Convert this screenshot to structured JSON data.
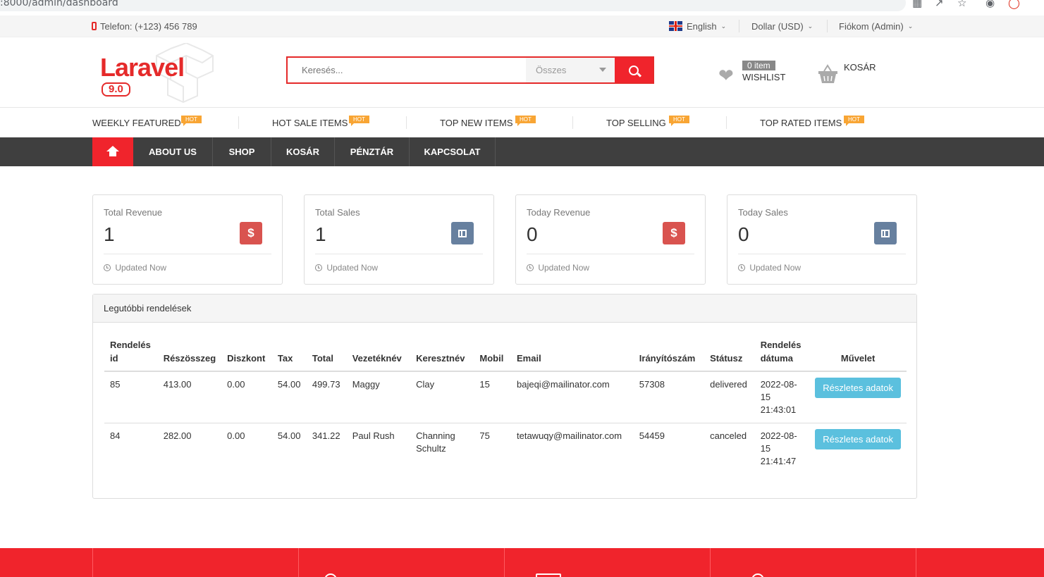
{
  "browser": {
    "url": ":8000/admin/dashboard"
  },
  "topbar": {
    "phone": "Telefon: (+123) 456 789",
    "language": "English",
    "currency": "Dollar (USD)",
    "account": "Fiókom (Admin)"
  },
  "header": {
    "logo_text": "Laravel",
    "logo_version": "9.0",
    "search_placeholder": "Keresés...",
    "search_category": "Összes",
    "wishlist_count": "0 item",
    "wishlist_label": "WISHLIST",
    "cart_label": "KOSÁR"
  },
  "featured": [
    {
      "label": "WEEKLY FEATURED",
      "badge": "HOT"
    },
    {
      "label": "HOT SALE ITEMS",
      "badge": "HOT"
    },
    {
      "label": "TOP NEW ITEMS",
      "badge": "HOT"
    },
    {
      "label": "TOP SELLING",
      "badge": "HOT"
    },
    {
      "label": "TOP RATED ITEMS",
      "badge": "HOT"
    }
  ],
  "nav": [
    "ABOUT US",
    "SHOP",
    "KOSÁR",
    "PÉNZTÁR",
    "KAPCSOLAT"
  ],
  "stats": [
    {
      "title": "Total Revenue",
      "value": "1",
      "icon": "dollar-icon",
      "color": "#d9534f",
      "foot": "Updated Now"
    },
    {
      "title": "Total Sales",
      "value": "1",
      "icon": "gift-icon",
      "color": "#67809f",
      "foot": "Updated Now"
    },
    {
      "title": "Today Revenue",
      "value": "0",
      "icon": "dollar-icon",
      "color": "#d9534f",
      "foot": "Updated Now"
    },
    {
      "title": "Today Sales",
      "value": "0",
      "icon": "gift-icon",
      "color": "#67809f",
      "foot": "Updated Now"
    }
  ],
  "orders": {
    "title": "Legutóbbi rendelések",
    "columns": [
      "Rendelés id",
      "Részösszeg",
      "Diszkont",
      "Tax",
      "Total",
      "Vezetéknév",
      "Keresztnév",
      "Mobil",
      "Email",
      "Irányítószám",
      "Státusz",
      "Rendelés dátuma",
      "Művelet"
    ],
    "rows": [
      {
        "id": "85",
        "subtotal": "413.00",
        "discount": "0.00",
        "tax": "54.00",
        "total": "499.73",
        "lastname": "Maggy",
        "firstname": "Clay",
        "mobile": "15",
        "email": "bajeqi@mailinator.com",
        "zip": "57308",
        "status": "delivered",
        "date": "2022-08-15 21:43:01",
        "action": "Részletes adatok"
      },
      {
        "id": "84",
        "subtotal": "282.00",
        "discount": "0.00",
        "tax": "54.00",
        "total": "341.22",
        "lastname": "Paul Rush",
        "firstname": "Channing Schultz",
        "mobile": "75",
        "email": "tetawuqy@mailinator.com",
        "zip": "54459",
        "status": "canceled",
        "date": "2022-08-15 21:41:47",
        "action": "Részletes adatok"
      }
    ]
  },
  "colors": {
    "brand_red": "#f0242c",
    "nav_dark": "#3f3f3f",
    "hot_badge": "#f8a534",
    "detail_button": "#5bc0de"
  }
}
